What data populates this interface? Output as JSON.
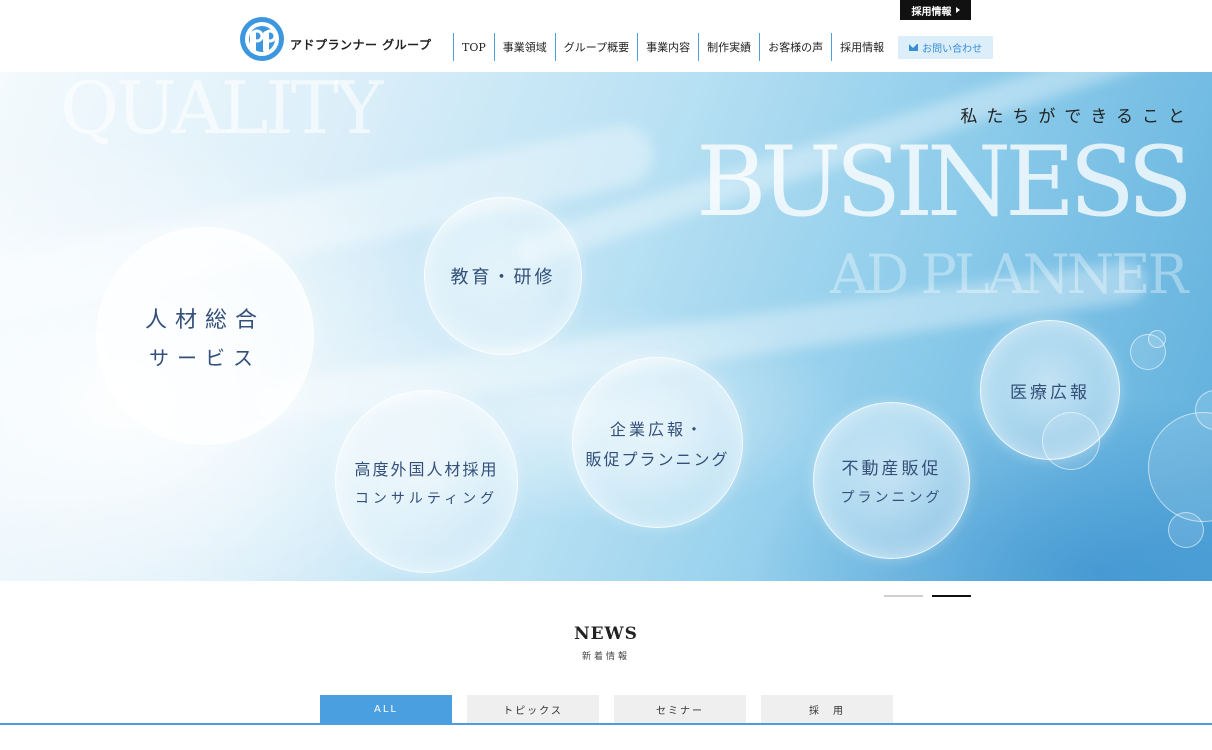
{
  "header": {
    "recruit_tab": "採用情報",
    "logo_text": "アドプランナー グループ",
    "nav": [
      "TOP",
      "事業領域",
      "グループ概要",
      "事業内容",
      "制作実績",
      "お客様の声",
      "採用情報"
    ],
    "contact_label": "お問い合わせ"
  },
  "hero": {
    "bg_words": [
      "QUALITY",
      "BUSINESS",
      "AD PLANNER"
    ],
    "tagline": "私たちができること",
    "bubbles": [
      {
        "line1": "人材総合",
        "line2": "サービス"
      },
      {
        "line1": "教育・研修",
        "line2": ""
      },
      {
        "line1": "高度外国人材採用",
        "line2": "コンサルティング"
      },
      {
        "line1": "企業広報・",
        "line2": "販促プランニング"
      },
      {
        "line1": "不動産販促",
        "line2": "プランニング"
      },
      {
        "line1": "医療広報",
        "line2": ""
      }
    ]
  },
  "slider": {
    "count": 2,
    "active": 2
  },
  "news": {
    "title": "NEWS",
    "subtitle": "新着情報",
    "tabs": [
      "ALL",
      "トピックス",
      "セミナー",
      "採　用"
    ],
    "active_tab": "ALL"
  },
  "colors": {
    "accent": "#4a9fe0",
    "contact_bg": "#dbeefa",
    "bubble_text": "#34507a",
    "recruit_bg": "#111111"
  },
  "icons": {
    "logo": "ap-logo-icon",
    "mail": "mail-icon",
    "arrow": "triangle-right-icon"
  }
}
